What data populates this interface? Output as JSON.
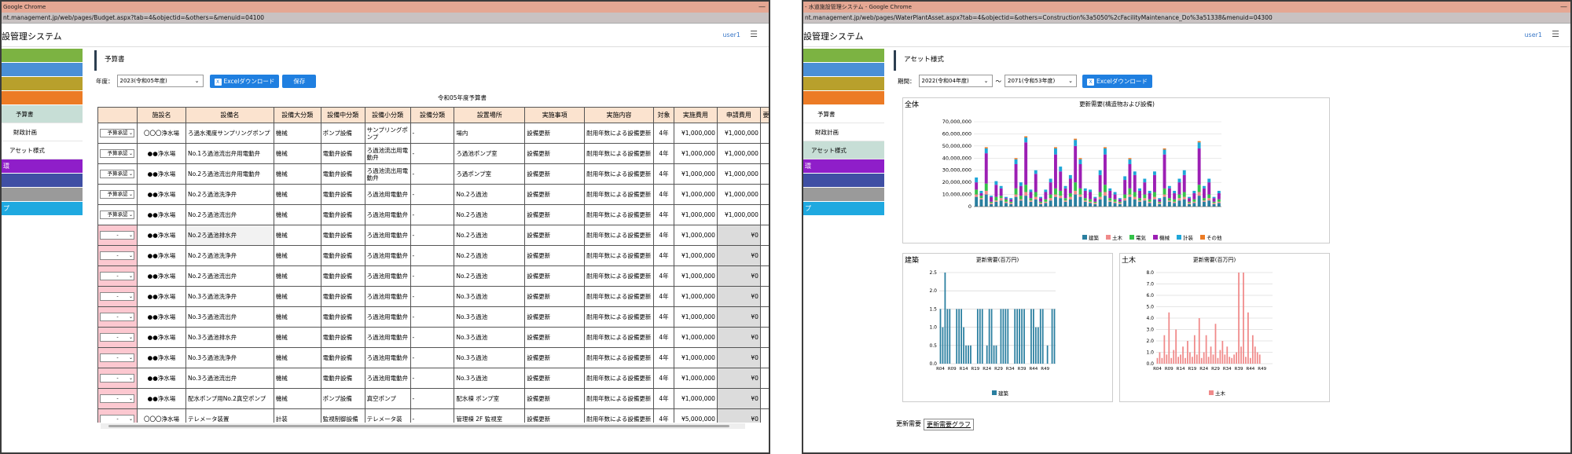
{
  "left": {
    "title_bar": "Google Chrome",
    "minimize": "—",
    "address": "nt.management.jp/web/pages/Budget.aspx?tab=4&objectid=&others=&menuid=04100",
    "app_name": "設管理システム",
    "user": "user1",
    "section": "予算書",
    "sidebar": {
      "colors": [
        "#7cb342",
        "#4a8fd6",
        "#b8a02c",
        "#ec7b25"
      ],
      "items": [
        "予算書",
        "財政計画",
        "アセット様式"
      ],
      "purple_label": "環",
      "bottom_label": "プ",
      "bottom_colors": [
        "#8f1ec9",
        "#3f4fa4",
        "#9a9a9a",
        "#1fa9e0"
      ]
    },
    "toolbar": {
      "year_label": "年度：",
      "year_value": "2023(令和05年度)",
      "excel_label": "Excelダウンロード",
      "save_label": "保存"
    },
    "table_title": "令和05年度予算書",
    "columns": [
      "",
      "施設名",
      "設備名",
      "設備大分類",
      "設備中分類",
      "設備小分類",
      "設備分類",
      "設置場所",
      "実施事項",
      "実施内容",
      "対象",
      "実施費用",
      "申請費用",
      "要"
    ],
    "rows": [
      {
        "status": "予算承認",
        "facility": "〇〇〇浄水場",
        "equipment": "ろ過水濁度サンプリングポンプ",
        "major": "機械",
        "middle": "ポンプ設備",
        "minor": "サンプリングポンプ",
        "cls": "-",
        "place": "場内",
        "action": "設備更新",
        "content": "耐用年数による設備更新",
        "target": "4年",
        "cost": "¥1,000,000",
        "applied": "¥1,000,000"
      },
      {
        "status": "予算承認",
        "facility": "●●浄水場",
        "equipment": "No.1ろ過池流出弁用電動弁",
        "major": "機械",
        "middle": "電動弁設備",
        "minor": "ろ過池流出用電動弁",
        "cls": "-",
        "place": "ろ過池ポンプ室",
        "action": "設備更新",
        "content": "耐用年数による設備更新",
        "target": "4年",
        "cost": "¥1,000,000",
        "applied": "¥1,000,000"
      },
      {
        "status": "予算承認",
        "facility": "●●浄水場",
        "equipment": "No.2ろ過池流出弁用電動弁",
        "major": "機械",
        "middle": "電動弁設備",
        "minor": "ろ過池流出用電動弁",
        "cls": "-",
        "place": "ろ過ポンプ室",
        "action": "設備更新",
        "content": "耐用年数による設備更新",
        "target": "4年",
        "cost": "¥1,000,000",
        "applied": "¥1,000,000"
      },
      {
        "status": "予算承認",
        "facility": "●●浄水場",
        "equipment": "No.2ろ過池洗浄弁",
        "major": "機械",
        "middle": "電動弁設備",
        "minor": "ろ過池用電動弁",
        "cls": "-",
        "place": "No.2ろ過池",
        "action": "設備更新",
        "content": "耐用年数による設備更新",
        "target": "4年",
        "cost": "¥1,000,000",
        "applied": "¥1,000,000"
      },
      {
        "status": "予算承認",
        "facility": "●●浄水場",
        "equipment": "No.2ろ過池流出弁",
        "major": "機械",
        "middle": "電動弁設備",
        "minor": "ろ過池用電動弁",
        "cls": "-",
        "place": "No.2ろ過池",
        "action": "設備更新",
        "content": "耐用年数による設備更新",
        "target": "4年",
        "cost": "¥1,000,000",
        "applied": "¥1,000,000"
      },
      {
        "status": "-",
        "facility": "●●浄水場",
        "equipment": "No.2ろ過池排水弁",
        "major": "機械",
        "middle": "電動弁設備",
        "minor": "ろ過池用電動弁",
        "cls": "-",
        "place": "No.2ろ過池",
        "action": "設備更新",
        "content": "耐用年数による設備更新",
        "target": "4年",
        "cost": "¥1,000,000",
        "applied": "¥0"
      },
      {
        "status": "-",
        "facility": "●●浄水場",
        "equipment": "No.2ろ過池洗浄弁",
        "major": "機械",
        "middle": "電動弁設備",
        "minor": "ろ過池用電動弁",
        "cls": "-",
        "place": "No.2ろ過池",
        "action": "設備更新",
        "content": "耐用年数による設備更新",
        "target": "4年",
        "cost": "¥1,000,000",
        "applied": "¥0"
      },
      {
        "status": "-",
        "facility": "●●浄水場",
        "equipment": "No.2ろ過池流出弁",
        "major": "機械",
        "middle": "電動弁設備",
        "minor": "ろ過池用電動弁",
        "cls": "-",
        "place": "No.2ろ過池",
        "action": "設備更新",
        "content": "耐用年数による設備更新",
        "target": "4年",
        "cost": "¥1,000,000",
        "applied": "¥0"
      },
      {
        "status": "-",
        "facility": "●●浄水場",
        "equipment": "No.3ろ過池洗浄弁",
        "major": "機械",
        "middle": "電動弁設備",
        "minor": "ろ過池用電動弁",
        "cls": "-",
        "place": "No.3ろ過池",
        "action": "設備更新",
        "content": "耐用年数による設備更新",
        "target": "4年",
        "cost": "¥1,000,000",
        "applied": "¥0"
      },
      {
        "status": "-",
        "facility": "●●浄水場",
        "equipment": "No.3ろ過池流出弁",
        "major": "機械",
        "middle": "電動弁設備",
        "minor": "ろ過池用電動弁",
        "cls": "-",
        "place": "No.3ろ過池",
        "action": "設備更新",
        "content": "耐用年数による設備更新",
        "target": "4年",
        "cost": "¥1,000,000",
        "applied": "¥0"
      },
      {
        "status": "-",
        "facility": "●●浄水場",
        "equipment": "No.3ろ過池排水弁",
        "major": "機械",
        "middle": "電動弁設備",
        "minor": "ろ過池用電動弁",
        "cls": "-",
        "place": "No.3ろ過池",
        "action": "設備更新",
        "content": "耐用年数による設備更新",
        "target": "4年",
        "cost": "¥1,000,000",
        "applied": "¥0"
      },
      {
        "status": "-",
        "facility": "●●浄水場",
        "equipment": "No.3ろ過池洗浄弁",
        "major": "機械",
        "middle": "電動弁設備",
        "minor": "ろ過池用電動弁",
        "cls": "-",
        "place": "No.3ろ過池",
        "action": "設備更新",
        "content": "耐用年数による設備更新",
        "target": "4年",
        "cost": "¥1,000,000",
        "applied": "¥0"
      },
      {
        "status": "-",
        "facility": "●●浄水場",
        "equipment": "No.3ろ過池流出弁",
        "major": "機械",
        "middle": "電動弁設備",
        "minor": "ろ過池用電動弁",
        "cls": "-",
        "place": "No.3ろ過池",
        "action": "設備更新",
        "content": "耐用年数による設備更新",
        "target": "4年",
        "cost": "¥1,000,000",
        "applied": "¥0"
      },
      {
        "status": "-",
        "facility": "●●浄水場",
        "equipment": "配水ポンプ用No.2真空ポンプ",
        "major": "機械",
        "middle": "ポンプ設備",
        "minor": "真空ポンプ",
        "cls": "-",
        "place": "配水棟 ポンプ室",
        "action": "設備更新",
        "content": "耐用年数による設備更新",
        "target": "4年",
        "cost": "¥1,000,000",
        "applied": "¥0"
      },
      {
        "status": "-",
        "facility": "〇〇〇浄水場",
        "equipment": "テレメータ装置",
        "major": "計装",
        "middle": "監視制御設備",
        "minor": "テレメータ装",
        "cls": "-",
        "place": "管理棟 2F 監視室",
        "action": "設備更新",
        "content": "耐用年数による設備更新",
        "target": "4年",
        "cost": "¥5,000,000",
        "applied": "¥0"
      }
    ]
  },
  "right": {
    "title_bar": "- 水道施設管理システム - Google Chrome",
    "minimize": "—",
    "address": "nt.management.jp/web/pages/WaterPlantAsset.aspx?tab=4&objectid=&others=Construction%3a5050%2cFacilityMaintenance_Do%3a51338&menuid=04300",
    "app_name": "設管理システム",
    "user": "user1",
    "section": "アセット様式",
    "sidebar": {
      "colors": [
        "#7cb342",
        "#4a8fd6",
        "#b8a02c",
        "#ec7b25"
      ],
      "items": [
        "予算書",
        "財政計画",
        "アセット様式"
      ],
      "purple_label": "環",
      "bottom_label": "プ",
      "bottom_colors": [
        "#8f1ec9",
        "#3f4fa4",
        "#9a9a9a",
        "#1fa9e0"
      ]
    },
    "toolbar": {
      "period_label": "期間：",
      "from_value": "2022(令和04年度)",
      "tilde": "〜",
      "to_value": "2071(令和53年度)",
      "excel_label": "Excelダウンロード"
    },
    "panel_all": "全体",
    "panel_arch": "建築",
    "panel_civil": "土木",
    "tabs": [
      "更新需要",
      "更新需要グラフ"
    ]
  },
  "chart_data": [
    {
      "type": "bar",
      "title": "更新需要(構造物および設備)",
      "ylim": [
        0,
        70000000
      ],
      "yticks": [
        "0",
        "10,000,000",
        "20,000,000",
        "30,000,000",
        "40,000,000",
        "50,000,000",
        "60,000,000",
        "70,000,000"
      ],
      "x_count": 50,
      "series": [
        {
          "name": "建築",
          "color": "#2a7fa0",
          "values": [
            8,
            6,
            10,
            2,
            4,
            5,
            3,
            2,
            8,
            5,
            9,
            4,
            6,
            2,
            3,
            5,
            8,
            7,
            4,
            6,
            10,
            8,
            4,
            3,
            2,
            6,
            9,
            4,
            3,
            2,
            5,
            8,
            6,
            4,
            5,
            3,
            6,
            2,
            8,
            4,
            3,
            5,
            6,
            2,
            3,
            9,
            4,
            5,
            2,
            3
          ]
        },
        {
          "name": "土木",
          "color": "#f08a8a",
          "values": [
            2,
            1,
            3,
            1,
            1,
            2,
            1,
            1,
            2,
            1,
            3,
            1,
            2,
            1,
            1,
            2,
            2,
            2,
            1,
            2,
            3,
            2,
            1,
            1,
            1,
            2,
            3,
            1,
            1,
            1,
            2,
            2,
            2,
            1,
            2,
            1,
            2,
            1,
            2,
            1,
            1,
            2,
            2,
            1,
            1,
            3,
            1,
            2,
            1,
            1
          ]
        },
        {
          "name": "電気",
          "color": "#35c24a",
          "values": [
            4,
            2,
            6,
            1,
            3,
            2,
            2,
            1,
            5,
            3,
            6,
            2,
            4,
            1,
            2,
            3,
            5,
            4,
            2,
            3,
            7,
            5,
            2,
            2,
            1,
            4,
            6,
            2,
            2,
            1,
            3,
            5,
            4,
            2,
            3,
            2,
            4,
            1,
            5,
            2,
            2,
            3,
            4,
            1,
            2,
            6,
            2,
            3,
            1,
            2
          ]
        },
        {
          "name": "機械",
          "color": "#9c1fb4",
          "values": [
            6,
            2,
            25,
            4,
            10,
            6,
            1,
            2,
            20,
            8,
            35,
            5,
            15,
            3,
            6,
            10,
            28,
            16,
            8,
            12,
            30,
            20,
            6,
            6,
            3,
            14,
            25,
            6,
            4,
            2,
            12,
            20,
            14,
            6,
            10,
            5,
            14,
            2,
            28,
            8,
            5,
            10,
            14,
            3,
            5,
            30,
            8,
            10,
            3,
            5
          ]
        },
        {
          "name": "計装",
          "color": "#1fa6d8",
          "values": [
            4,
            2,
            4,
            1,
            3,
            2,
            1,
            1,
            4,
            3,
            4,
            2,
            3,
            1,
            2,
            3,
            5,
            4,
            2,
            3,
            5,
            4,
            2,
            2,
            1,
            4,
            5,
            2,
            2,
            1,
            3,
            4,
            3,
            2,
            3,
            2,
            3,
            1,
            4,
            2,
            2,
            3,
            4,
            1,
            2,
            5,
            2,
            3,
            1,
            2
          ]
        },
        {
          "name": "その他",
          "color": "#ec7b25",
          "values": [
            0,
            0,
            1,
            0,
            0,
            0,
            0,
            0,
            1,
            0,
            1,
            0,
            0,
            0,
            0,
            0,
            1,
            0,
            0,
            0,
            1,
            1,
            0,
            0,
            0,
            0,
            1,
            0,
            0,
            0,
            0,
            1,
            0,
            0,
            0,
            0,
            0,
            0,
            1,
            0,
            0,
            0,
            0,
            0,
            0,
            1,
            0,
            0,
            0,
            0
          ]
        }
      ],
      "unit_scale": 1000000,
      "legend_position": "bottom"
    },
    {
      "type": "bar",
      "title": "更新需要(百万円)",
      "ylim": [
        0,
        2.5
      ],
      "yticks": [
        "0.0",
        "0.5",
        "1.0",
        "1.5",
        "2.0",
        "2.5"
      ],
      "categories": [
        "R04",
        "",
        "",
        "",
        "",
        "R09",
        "",
        "",
        "",
        "",
        "R14",
        "",
        "",
        "",
        "",
        "R19",
        "",
        "",
        "",
        "",
        "R24",
        "",
        "",
        "",
        "",
        "R29",
        "",
        "",
        "",
        "",
        "R34",
        "",
        "",
        "",
        "",
        "R39",
        "",
        "",
        "",
        "",
        "R44",
        "",
        "",
        "",
        "",
        "R49",
        "",
        "",
        "",
        ""
      ],
      "series": [
        {
          "name": "建築",
          "color": "#2a7fa0",
          "values": [
            1.5,
            1.0,
            2.5,
            1.5,
            1.5,
            0,
            0,
            1.5,
            1.5,
            1.5,
            1.0,
            0.5,
            0.5,
            0.5,
            0,
            0,
            1.5,
            1.5,
            1.5,
            0,
            0.5,
            1.5,
            1.5,
            0.5,
            0.5,
            0,
            1.5,
            1.5,
            1.5,
            1.5,
            0,
            0,
            1.5,
            1.5,
            1.5,
            1.5,
            1.5,
            0,
            0,
            1.5,
            1.5,
            1.0,
            1.0,
            1.5,
            1.5,
            0,
            0.5,
            0,
            1.5,
            1.5
          ]
        }
      ],
      "legend_position": "bottom"
    },
    {
      "type": "bar",
      "title": "更新需要(百万円)",
      "ylim": [
        0,
        8.0
      ],
      "yticks": [
        "0.0",
        "1.0",
        "2.0",
        "3.0",
        "4.0",
        "5.0",
        "6.0",
        "7.0",
        "8.0"
      ],
      "categories": [
        "R04",
        "",
        "",
        "",
        "",
        "R09",
        "",
        "",
        "",
        "",
        "R14",
        "",
        "",
        "",
        "",
        "R19",
        "",
        "",
        "",
        "",
        "R24",
        "",
        "",
        "",
        "",
        "R29",
        "",
        "",
        "",
        "",
        "R34",
        "",
        "",
        "",
        "",
        "R39",
        "",
        "",
        "",
        "",
        "R44",
        "",
        "",
        "",
        "",
        "R49",
        "",
        "",
        "",
        ""
      ],
      "series": [
        {
          "name": "土木",
          "color": "#f08a8a",
          "values": [
            0.5,
            1.0,
            0.5,
            2.5,
            0.8,
            4.5,
            0.5,
            1.2,
            3.0,
            0.6,
            0.8,
            1.5,
            0.5,
            2.0,
            1.0,
            0.6,
            2.5,
            0.8,
            4.0,
            0.5,
            1.0,
            2.5,
            0.6,
            1.5,
            0.8,
            3.5,
            0.5,
            1.2,
            2.0,
            0.8,
            1.5,
            0.6,
            0.5,
            0.8,
            1.0,
            8.0,
            1.5,
            8.0,
            0.6,
            4.5,
            0.5,
            2.5,
            1.5,
            1.0,
            0.8,
            0,
            0,
            0,
            0,
            0
          ]
        }
      ],
      "legend_position": "bottom"
    }
  ]
}
